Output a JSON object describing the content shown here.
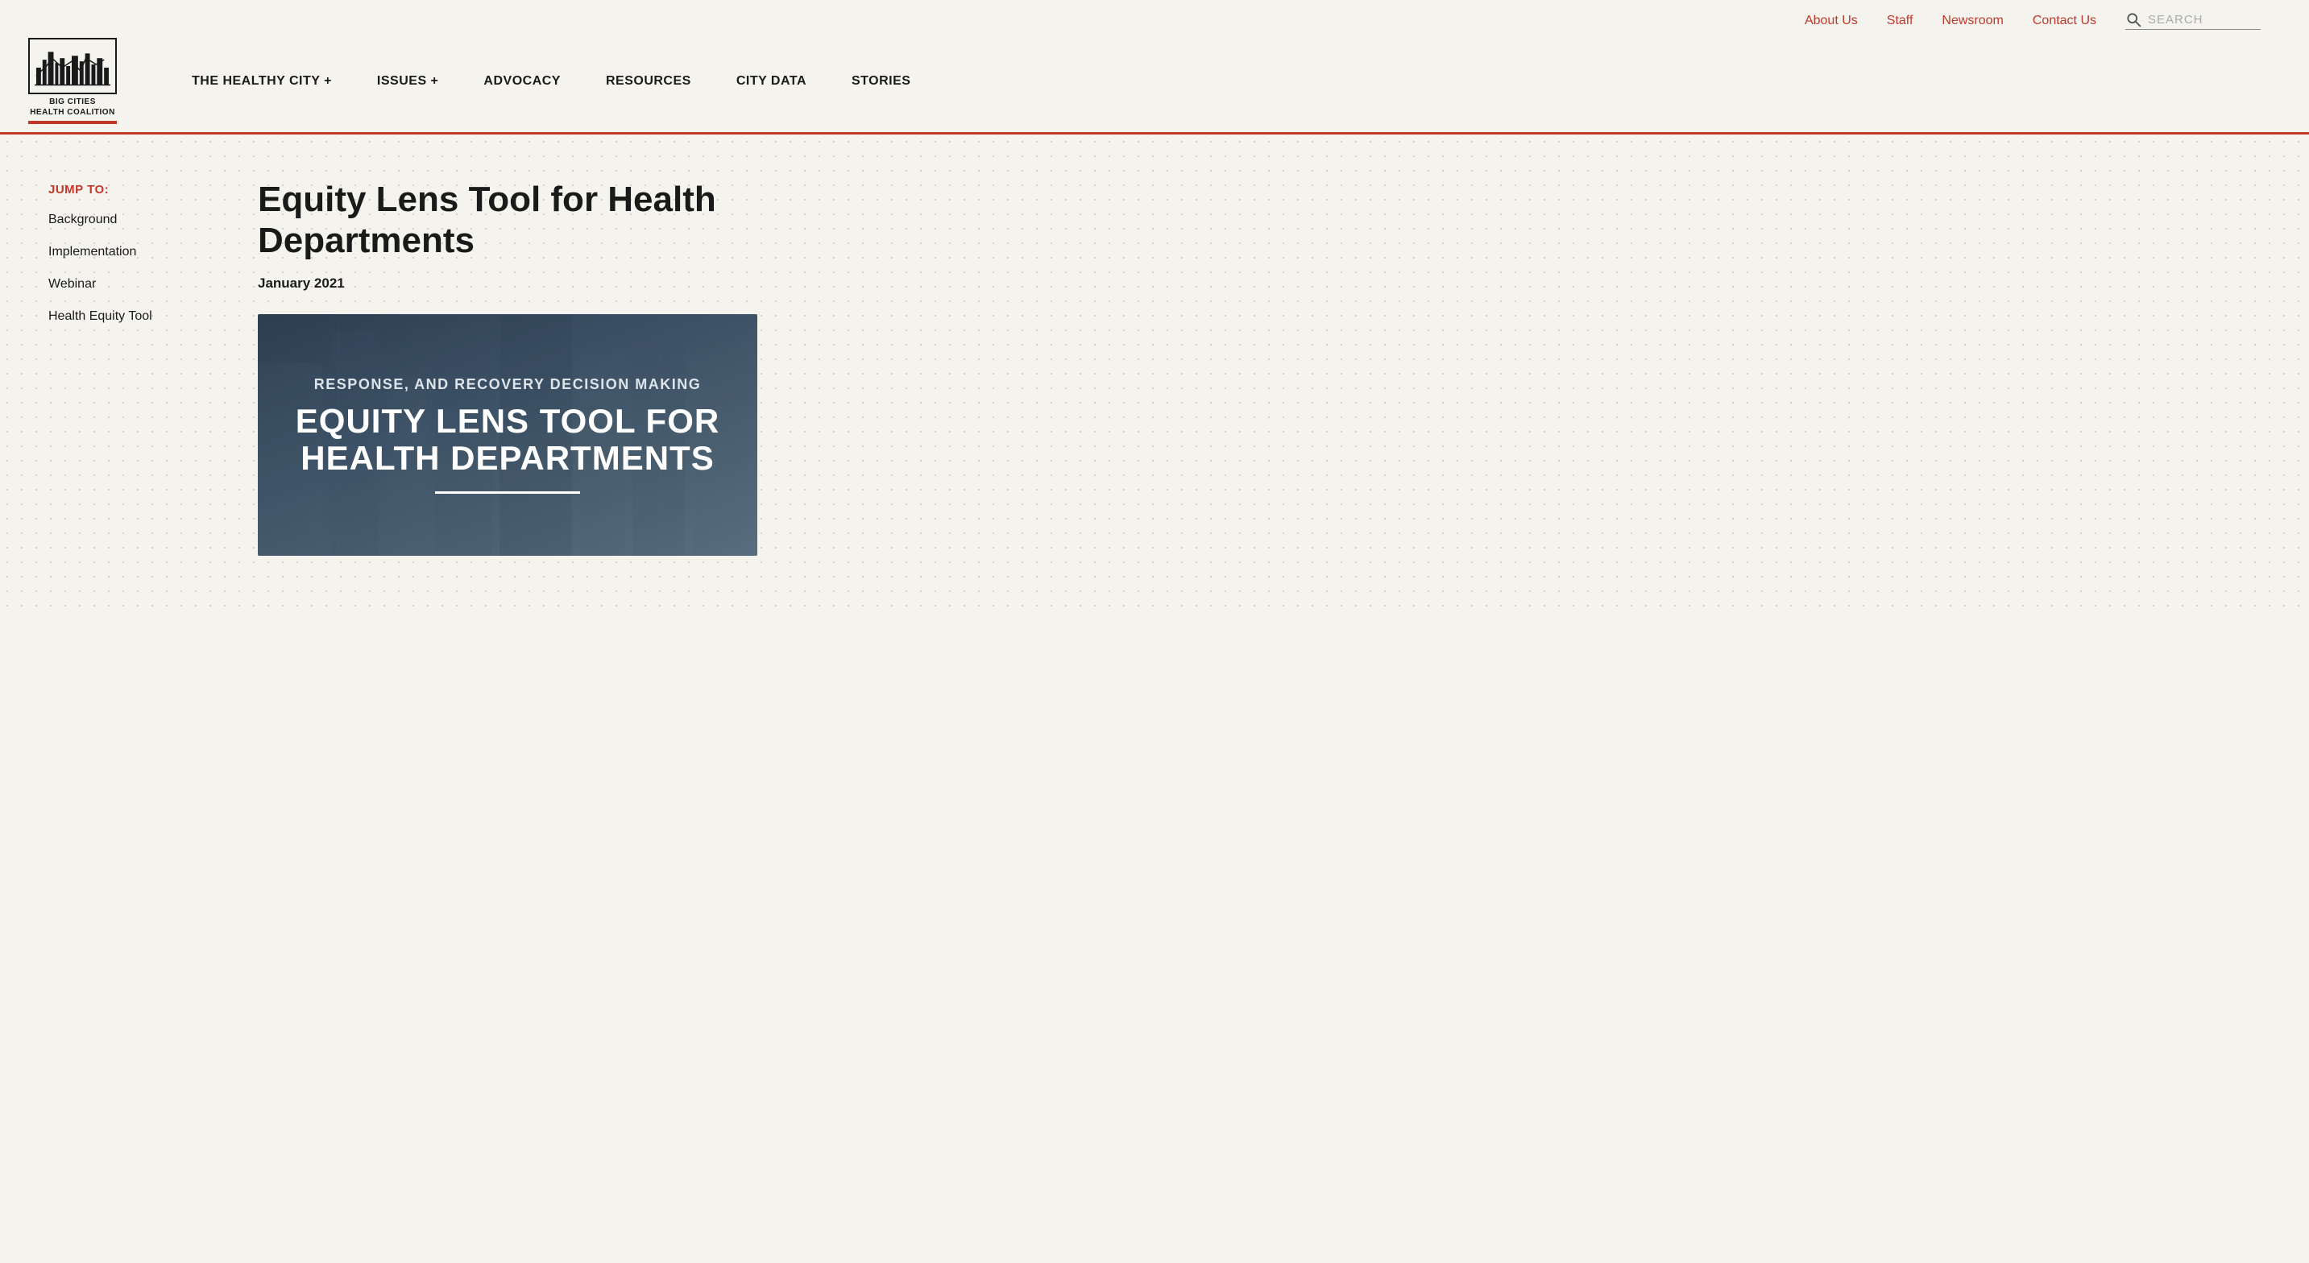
{
  "site": {
    "logo_line1": "BIG CITIES",
    "logo_line2": "HEALTH COALITION"
  },
  "top_nav": {
    "items": [
      {
        "label": "About Us",
        "href": "#"
      },
      {
        "label": "Staff",
        "href": "#"
      },
      {
        "label": "Newsroom",
        "href": "#"
      },
      {
        "label": "Contact Us",
        "href": "#"
      }
    ],
    "search_placeholder": "SEARCH"
  },
  "main_nav": {
    "items": [
      {
        "label": "THE HEALTHY CITY",
        "has_plus": true
      },
      {
        "label": "ISSUES",
        "has_plus": true
      },
      {
        "label": "ADVOCACY",
        "has_plus": false
      },
      {
        "label": "RESOURCES",
        "has_plus": false
      },
      {
        "label": "CITY DATA",
        "has_plus": false
      },
      {
        "label": "STORIES",
        "has_plus": false
      }
    ]
  },
  "sidebar": {
    "jump_to_label": "JUMP TO:",
    "links": [
      {
        "label": "Background"
      },
      {
        "label": "Implementation"
      },
      {
        "label": "Webinar"
      },
      {
        "label": "Health Equity Tool"
      }
    ]
  },
  "main": {
    "page_title": "Equity Lens Tool for Health Departments",
    "date": "January 2021",
    "image_subtitle": "RESPONSE, AND RECOVERY DECISION MAKING",
    "image_title_line1": "EQUITY LENS TOOL FOR",
    "image_title_line2": "HEALTH DEPARTMENTS"
  }
}
